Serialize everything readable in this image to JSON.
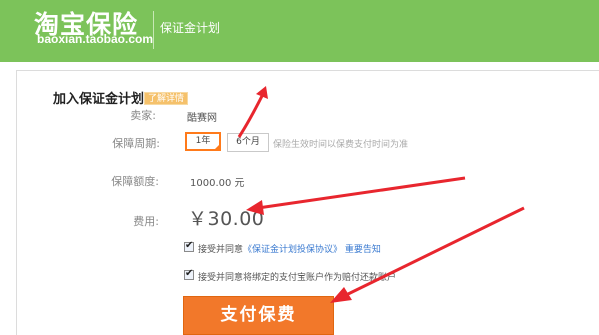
{
  "header": {
    "brand_title": "淘宝保险",
    "brand_url": "baoxian.taobao.com",
    "subtitle": "保证金计划"
  },
  "panel": {
    "title": "加入保证金计划",
    "tooltip": "了解详情"
  },
  "seller": {
    "label": "卖家:",
    "value": "酷赛网"
  },
  "period": {
    "label": "保障周期:",
    "options": [
      "1年",
      "6个月"
    ],
    "selected": "1年",
    "hint": "保险生效时间以保费支付时间为准"
  },
  "amount": {
    "label": "保障额度:",
    "value": "1000.00 元"
  },
  "fee": {
    "label": "费用:",
    "value": "￥30.00"
  },
  "agreements": [
    {
      "checked": true,
      "text": "接受并同意",
      "link": "《保证金计划投保协议》",
      "link2": "重要告知"
    },
    {
      "checked": true,
      "text": "接受并同意将绑定的支付宝账户作为赔付还款账户"
    }
  ],
  "pay_button": {
    "label": "支付保费"
  },
  "colors": {
    "header": "#7cc35a",
    "accent": "#f2782a",
    "arrow": "#e8262e",
    "link": "#3a7ad0"
  },
  "icons": {
    "checkbox": "check-icon",
    "annotation": "arrow-icon"
  }
}
